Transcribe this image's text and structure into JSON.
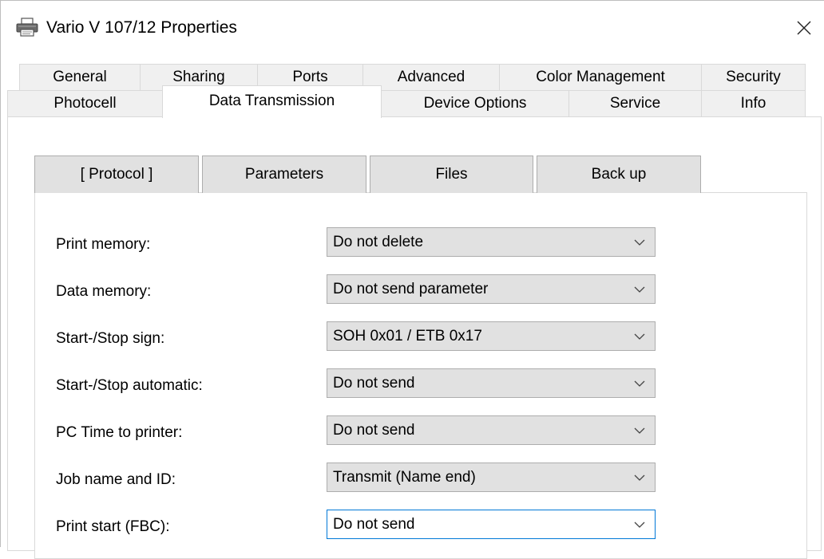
{
  "window": {
    "title": "Vario V 107/12 Properties",
    "icon": "printer-icon",
    "close_glyph": "✕"
  },
  "outer_tabs": {
    "row1": [
      "General",
      "Sharing",
      "Ports",
      "Advanced",
      "Color Management",
      "Security"
    ],
    "row2": [
      "Photocell",
      "Data Transmission",
      "Device Options",
      "Service",
      "Info"
    ],
    "selected": "Data Transmission"
  },
  "inner_tabs": {
    "items": [
      "[ Protocol ]",
      "Parameters",
      "Files",
      "Back up"
    ],
    "selected": "[ Protocol ]"
  },
  "settings": [
    {
      "label": "Print memory:",
      "value": "Do not delete"
    },
    {
      "label": "Data memory:",
      "value": "Do not send parameter"
    },
    {
      "label": "Start-/Stop sign:",
      "value": "SOH 0x01 / ETB 0x17"
    },
    {
      "label": "Start-/Stop automatic:",
      "value": "Do not send"
    },
    {
      "label": "PC Time to printer:",
      "value": "Do not send"
    },
    {
      "label": "Job name and ID:",
      "value": "Transmit (Name end)"
    },
    {
      "label": "Print start (FBC):",
      "value": "Do not send"
    }
  ],
  "colors": {
    "focus_border": "#0078d7",
    "combo_bg": "#e1e1e1",
    "tab_bg": "#f0f0f0"
  }
}
